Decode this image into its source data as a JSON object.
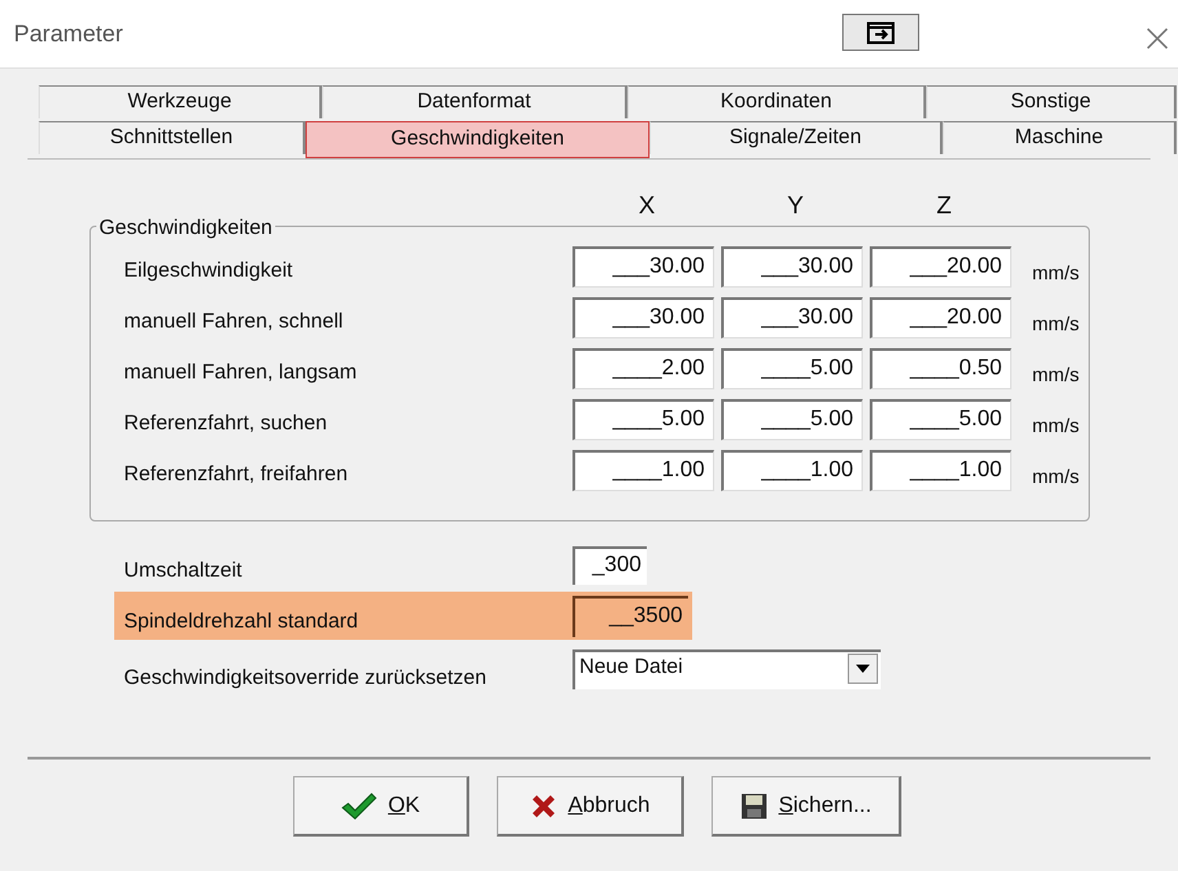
{
  "window": {
    "title": "Parameter"
  },
  "tabs": [
    [
      {
        "label": "Werkzeuge",
        "selected": false
      },
      {
        "label": "Datenformat",
        "selected": false
      },
      {
        "label": "Koordinaten",
        "selected": false
      },
      {
        "label": "Sonstige",
        "selected": false
      }
    ],
    [
      {
        "label": "Schnittstellen",
        "selected": false
      },
      {
        "label": "Geschwindigkeiten",
        "selected": true
      },
      {
        "label": "Signale/Zeiten",
        "selected": false
      },
      {
        "label": "Maschine",
        "selected": false
      }
    ]
  ],
  "axes": [
    "X",
    "Y",
    "Z"
  ],
  "group": {
    "title": "Geschwindigkeiten",
    "rows": [
      {
        "label": "Eilgeschwindigkeit",
        "values": [
          "___30.00",
          "___30.00",
          "___20.00"
        ],
        "unit": "mm/s"
      },
      {
        "label": "manuell Fahren, schnell",
        "values": [
          "___30.00",
          "___30.00",
          "___20.00"
        ],
        "unit": "mm/s"
      },
      {
        "label": "manuell Fahren, langsam",
        "values": [
          "____2.00",
          "____5.00",
          "____0.50"
        ],
        "unit": "mm/s"
      },
      {
        "label": "Referenzfahrt, suchen",
        "values": [
          "____5.00",
          "____5.00",
          "____5.00"
        ],
        "unit": "mm/s"
      },
      {
        "label": "Referenzfahrt, freifahren",
        "values": [
          "____1.00",
          "____1.00",
          "____1.00"
        ],
        "unit": "mm/s"
      }
    ]
  },
  "settings": [
    {
      "kind": "field",
      "label": "Umschaltzeit",
      "value": "_300",
      "highlighted": false
    },
    {
      "kind": "field",
      "label": "Spindeldrehzahl standard",
      "value": "__3500",
      "highlighted": true
    },
    {
      "kind": "dropdown",
      "label": "Geschwindigkeitsoverride zurücksetzen",
      "value": "Neue Datei",
      "highlighted": false
    }
  ],
  "buttons": [
    {
      "kind": "ok",
      "label": "OK",
      "underline_first": true
    },
    {
      "kind": "cancel",
      "label": "Abbruch",
      "underline_first": true
    },
    {
      "kind": "save",
      "label": "Sichern...",
      "underline_first": true
    }
  ]
}
